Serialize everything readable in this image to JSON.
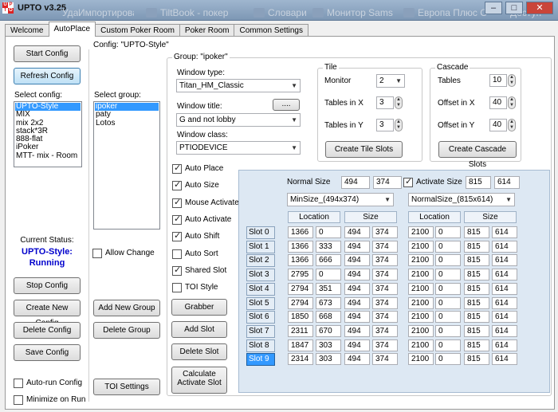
{
  "app": {
    "title": "UPTO v3.25",
    "logo": [
      "U",
      "P",
      "T",
      "O"
    ]
  },
  "background_tabs": [
    "Удалить",
    "Импортировано",
    "TiltBook - покер",
    "Словари",
    "Монитор Sams",
    "Европа Плюс С",
    "Доступ"
  ],
  "window_buttons": {
    "minimize": "–",
    "maximize": "□",
    "close": "✕"
  },
  "tabs": [
    "Welcome",
    "AutoPlace",
    "Custom Poker Room",
    "Poker Room",
    "Common Settings"
  ],
  "left": {
    "start": "Start Config",
    "refresh": "Refresh Config",
    "select_config": "Select config:",
    "configs": [
      "UPTO-Style",
      "MIX",
      "mix 2x2",
      "stack*3R",
      "888-flat",
      "iPoker",
      "MTT- mix - Room"
    ],
    "current_status_label": "Current Status:",
    "status_name": "UPTO-Style:",
    "status_state": "Running",
    "stop": "Stop Config",
    "create": "Create New Config",
    "delete": "Delete Config",
    "save": "Save Config",
    "autorun": "Auto-run Config",
    "minimize": "Minimize on Run"
  },
  "config_title": "Config: \"UPTO-Style\"",
  "groups": {
    "select_group": "Select group:",
    "items": [
      "ipoker",
      "paty",
      "Lotos"
    ],
    "allow_change": "Allow Change",
    "add": "Add New Group",
    "delete": "Delete Group",
    "toi": "TOI Settings"
  },
  "group": {
    "title": "Group: \"ipoker\"",
    "window_type_label": "Window type:",
    "window_type": "Titan_HM_Classic",
    "window_title_label": "Window title:",
    "title_btn": "....",
    "window_title": "G and not lobby",
    "window_class_label": "Window class:",
    "window_class": "PTIODEVICE"
  },
  "tile": {
    "title": "Tile",
    "monitor_label": "Monitor",
    "monitor": "2",
    "x_label": "Tables in X",
    "x": "3",
    "y_label": "Tables in Y",
    "y": "3",
    "btn": "Create Tile Slots"
  },
  "cascade": {
    "title": "Cascade",
    "tables_label": "Tables",
    "tables": "10",
    "ox_label": "Offset in X",
    "ox": "40",
    "oy_label": "Offset in Y",
    "oy": "40",
    "btn": "Create Cascade Slots"
  },
  "options": [
    "Auto Place",
    "Auto Size",
    "Mouse Activate",
    "Auto Activate",
    "Auto Shift",
    "Auto Sort",
    "Shared Slot",
    "TOI Style"
  ],
  "options_checked": [
    true,
    true,
    true,
    true,
    true,
    false,
    true,
    false
  ],
  "actions": {
    "grabber": "Grabber",
    "add": "Add Slot",
    "delete": "Delete Slot",
    "calc": [
      "Calculate",
      "Activate Slot"
    ]
  },
  "slots": {
    "normal_size_label": "Normal Size",
    "normal_w": "494",
    "normal_h": "374",
    "activate_size_label": "Activate Size",
    "activate_w": "815",
    "activate_h": "614",
    "min_size_select": "MinSize_(494x374)",
    "normal_size_select": "NormalSize_(815x614)",
    "headers": [
      "Location",
      "Size",
      "Location",
      "Size"
    ],
    "rows": [
      {
        "name": "Slot 0",
        "l1": [
          "1366",
          "0"
        ],
        "s1": [
          "494",
          "374"
        ],
        "l2": [
          "2100",
          "0"
        ],
        "s2": [
          "815",
          "614"
        ]
      },
      {
        "name": "Slot 1",
        "l1": [
          "1366",
          "333"
        ],
        "s1": [
          "494",
          "374"
        ],
        "l2": [
          "2100",
          "0"
        ],
        "s2": [
          "815",
          "614"
        ]
      },
      {
        "name": "Slot 2",
        "l1": [
          "1366",
          "666"
        ],
        "s1": [
          "494",
          "374"
        ],
        "l2": [
          "2100",
          "0"
        ],
        "s2": [
          "815",
          "614"
        ]
      },
      {
        "name": "Slot 3",
        "l1": [
          "2795",
          "0"
        ],
        "s1": [
          "494",
          "374"
        ],
        "l2": [
          "2100",
          "0"
        ],
        "s2": [
          "815",
          "614"
        ]
      },
      {
        "name": "Slot 4",
        "l1": [
          "2794",
          "351"
        ],
        "s1": [
          "494",
          "374"
        ],
        "l2": [
          "2100",
          "0"
        ],
        "s2": [
          "815",
          "614"
        ]
      },
      {
        "name": "Slot 5",
        "l1": [
          "2794",
          "673"
        ],
        "s1": [
          "494",
          "374"
        ],
        "l2": [
          "2100",
          "0"
        ],
        "s2": [
          "815",
          "614"
        ]
      },
      {
        "name": "Slot 6",
        "l1": [
          "1850",
          "668"
        ],
        "s1": [
          "494",
          "374"
        ],
        "l2": [
          "2100",
          "0"
        ],
        "s2": [
          "815",
          "614"
        ]
      },
      {
        "name": "Slot 7",
        "l1": [
          "2311",
          "670"
        ],
        "s1": [
          "494",
          "374"
        ],
        "l2": [
          "2100",
          "0"
        ],
        "s2": [
          "815",
          "614"
        ]
      },
      {
        "name": "Slot 8",
        "l1": [
          "1847",
          "303"
        ],
        "s1": [
          "494",
          "374"
        ],
        "l2": [
          "2100",
          "0"
        ],
        "s2": [
          "815",
          "614"
        ]
      },
      {
        "name": "Slot 9",
        "l1": [
          "2314",
          "303"
        ],
        "s1": [
          "494",
          "374"
        ],
        "l2": [
          "2100",
          "0"
        ],
        "s2": [
          "815",
          "614"
        ]
      }
    ]
  },
  "colors": {
    "status_blue": "#0000cc",
    "selection": "#3399ff"
  }
}
